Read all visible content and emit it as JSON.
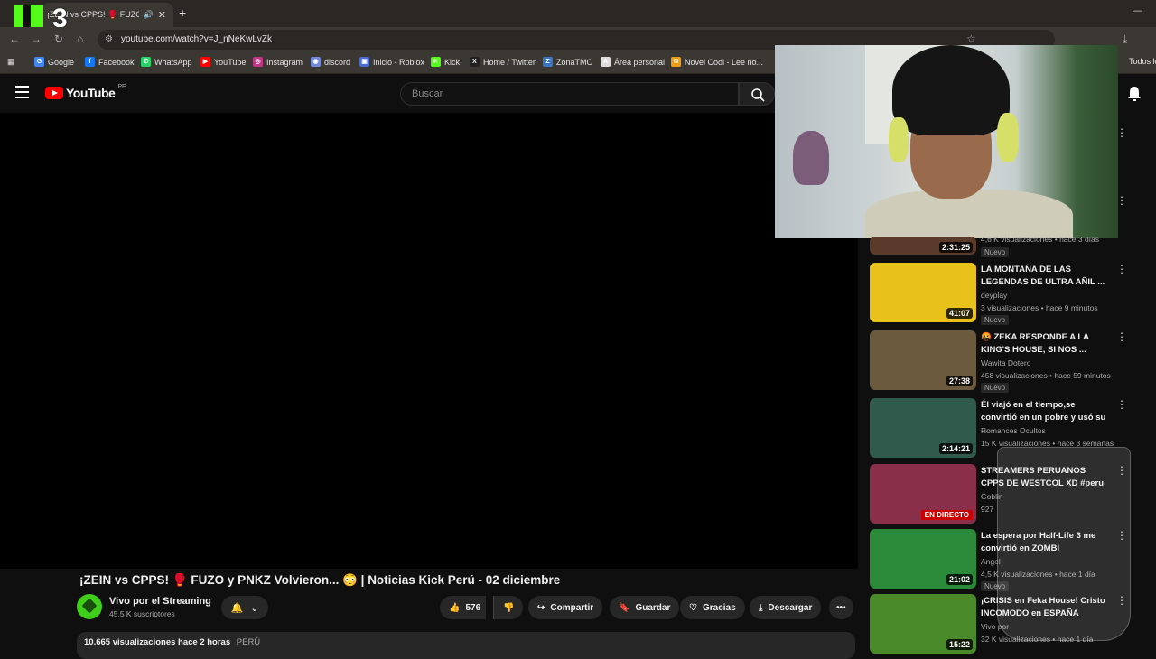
{
  "browser": {
    "tab_title": "¡ZEIN vs CPPS! 🥊 FUZO",
    "url": "youtube.com/watch?v=J_nNeKwLvZk",
    "bookmarks": [
      {
        "label": "Google",
        "color": "#4285f4",
        "glyph": "G"
      },
      {
        "label": "Facebook",
        "color": "#1877f2",
        "glyph": "f"
      },
      {
        "label": "WhatsApp",
        "color": "#25d366",
        "glyph": "✆"
      },
      {
        "label": "YouTube",
        "color": "#ff0000",
        "glyph": "▶"
      },
      {
        "label": "Instagram",
        "color": "#c13584",
        "glyph": "◎"
      },
      {
        "label": "discord",
        "color": "#7289da",
        "glyph": "◉"
      },
      {
        "label": "Inicio - Roblox",
        "color": "#4a6cd4",
        "glyph": "▣"
      },
      {
        "label": "Kick",
        "color": "#53fc18",
        "glyph": "K"
      },
      {
        "label": "Home / Twitter",
        "color": "#222222",
        "glyph": "X"
      },
      {
        "label": "ZonaTMO",
        "color": "#3a76c4",
        "glyph": "Z"
      },
      {
        "label": "Área personal",
        "color": "#dddddd",
        "glyph": "A"
      },
      {
        "label": "Novel Cool - Lee no...",
        "color": "#f39c12",
        "glyph": "N"
      }
    ],
    "all_bookmarks_label": "Todos los"
  },
  "overlay": {
    "kick_number": "3"
  },
  "youtube": {
    "logo_text": "YouTube",
    "country_code": "PE",
    "search_placeholder": "Buscar"
  },
  "video": {
    "title": "¡ZEIN vs CPPS! 🥊 FUZO y PNKZ Volvieron... 😳 | Noticias Kick Perú - 02 diciembre",
    "channel": "Vivo por el Streaming",
    "subscribers": "45,5 K suscriptores",
    "likes": "576",
    "actions": {
      "share": "Compartir",
      "save": "Guardar",
      "thanks": "Gracias",
      "download": "Descargar"
    },
    "description_meta": "10.665 visualizaciones  hace 2 horas",
    "description_tag": "PERÚ"
  },
  "sidebar": {
    "first_partial": {
      "duration": "2:31:25",
      "meta": "4,6 K visualizaciones • hace 3 días",
      "badge": "Nuevo"
    },
    "items": [
      {
        "title": "LA MONTAÑA DE LAS LEGENDAS DE ULTRA AÑIL ...",
        "channel": "deyplay",
        "meta": "3 visualizaciones • hace 9 minutos",
        "badge": "Nuevo",
        "duration": "41:07",
        "thumb": "#e8c21a"
      },
      {
        "title": "🤬 ZEKA RESPONDE A LA KING'S HOUSE, SI NOS ...",
        "channel": "Wawita Dotero",
        "meta": "458 visualizaciones • hace 59 minutos",
        "badge": "Nuevo",
        "duration": "27:38",
        "thumb": "#6b5a3e"
      },
      {
        "title": "Él viajó en el tiempo,se convirtió en un pobre y usó su ...",
        "channel": "Romances Ocultos",
        "meta": "15 K visualizaciones • hace 3 semanas",
        "badge": "",
        "duration": "2:14:21",
        "thumb": "#2f5a4c"
      },
      {
        "title": "STREAMERS PERUANOS CPPS DE WESTCOL XD #peru",
        "channel": "Goblin",
        "meta": "927",
        "badge": "",
        "duration": "EN DIRECTO",
        "thumb": "#8a2f4a"
      },
      {
        "title": "La espera por Half-Life 3 me convirtió en ZOMBI",
        "channel": "Angel",
        "meta": "4,5 K visualizaciones • hace 1 día",
        "badge": "Nuevo",
        "duration": "21:02",
        "thumb": "#2a8a3a"
      },
      {
        "title": "¡CRISIS en Feka House! Cristo INCOMODO en ESPAÑA",
        "channel": "Vivo por",
        "meta": "32 K visualizaciones • hace 1 día",
        "badge": "",
        "duration": "15:22",
        "thumb": "#4a8a2a"
      }
    ]
  }
}
